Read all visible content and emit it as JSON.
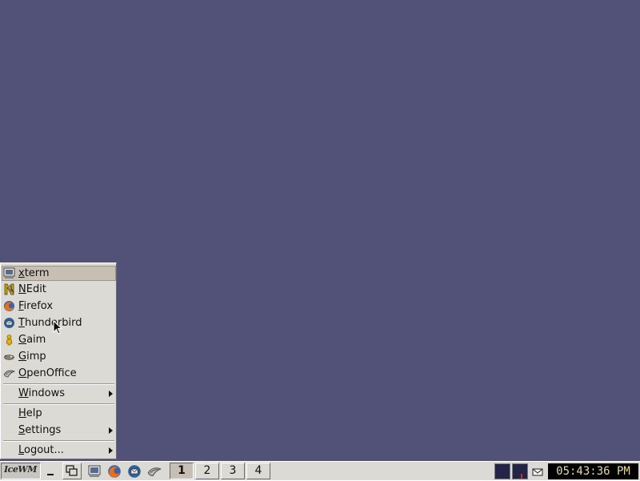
{
  "menu": {
    "items": [
      {
        "label": "xterm",
        "icon": "terminal-icon"
      },
      {
        "label": "NEdit",
        "icon": "nedit-icon"
      },
      {
        "label": "Firefox",
        "icon": "firefox-icon"
      },
      {
        "label": "Thunderbird",
        "icon": "thunderbird-icon"
      },
      {
        "label": "Gaim",
        "icon": "gaim-icon"
      },
      {
        "label": "Gimp",
        "icon": "gimp-icon"
      },
      {
        "label": "OpenOffice",
        "icon": "openoffice-icon"
      }
    ],
    "windows_label": "Windows",
    "help_label": "Help",
    "settings_label": "Settings",
    "logout_label": "Logout...",
    "active_item": "xterm"
  },
  "taskbar": {
    "start_logo": "IceWM",
    "workspaces": [
      "1",
      "2",
      "3",
      "4"
    ],
    "active_workspace": "1",
    "quicklaunch": [
      "terminal-icon",
      "firefox-icon",
      "thunderbird-icon",
      "openoffice-icon"
    ],
    "clock": "05:43:36 PM"
  },
  "colors": {
    "desktop": "#525278",
    "panel": "#dcdad5",
    "highlight": "#c8bfb4",
    "clock_bg": "#000000",
    "clock_fg": "#e8d7a6"
  }
}
